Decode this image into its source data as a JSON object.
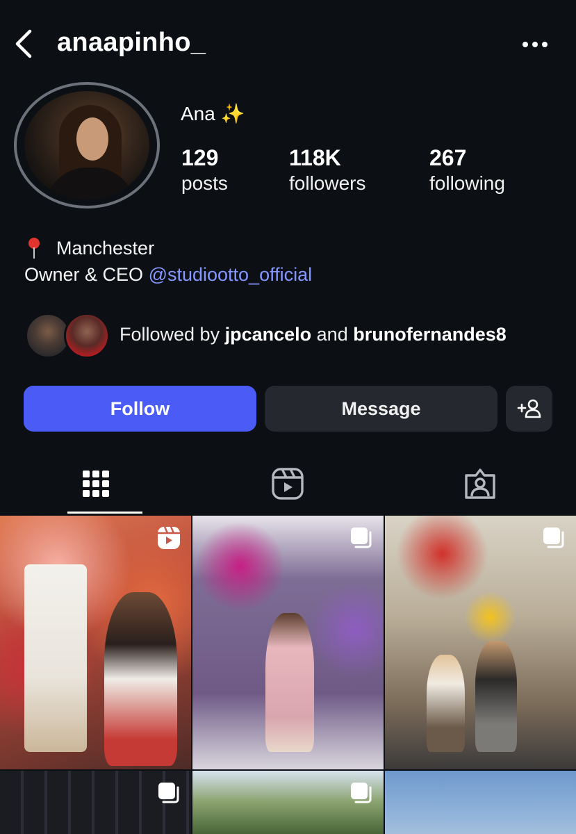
{
  "header": {
    "username": "anaapinho_"
  },
  "profile": {
    "display_name": "Ana",
    "sparkle": "✨",
    "stats": [
      {
        "value": "129",
        "label": "posts"
      },
      {
        "value": "118K",
        "label": "followers"
      },
      {
        "value": "267",
        "label": "following"
      }
    ],
    "location": "Manchester",
    "bio_prefix": "Owner & CEO",
    "bio_link": "@studiootto_official"
  },
  "followed_by": {
    "prefix": "Followed by",
    "user1": "jpcancelo",
    "connector": "and",
    "user2": "brunofernandes8"
  },
  "actions": {
    "follow_label": "Follow",
    "message_label": "Message"
  },
  "tabs": [
    {
      "name": "posts-grid",
      "icon": "grid-icon",
      "active": true
    },
    {
      "name": "reels",
      "icon": "reels-icon",
      "active": false
    },
    {
      "name": "tagged",
      "icon": "tagged-user-icon",
      "active": false
    }
  ],
  "grid_posts": [
    {
      "type": "reel",
      "icon": "reel-icon"
    },
    {
      "type": "carousel",
      "icon": "carousel-icon"
    },
    {
      "type": "carousel",
      "icon": "carousel-icon"
    },
    {
      "type": "carousel",
      "icon": "carousel-icon"
    },
    {
      "type": "carousel",
      "icon": "carousel-icon"
    },
    {
      "type": "image",
      "icon": ""
    }
  ],
  "colors": {
    "background": "#0c0f14",
    "follow_button": "#4a5cf5",
    "secondary_button": "#25282e",
    "link": "#8596ff"
  }
}
